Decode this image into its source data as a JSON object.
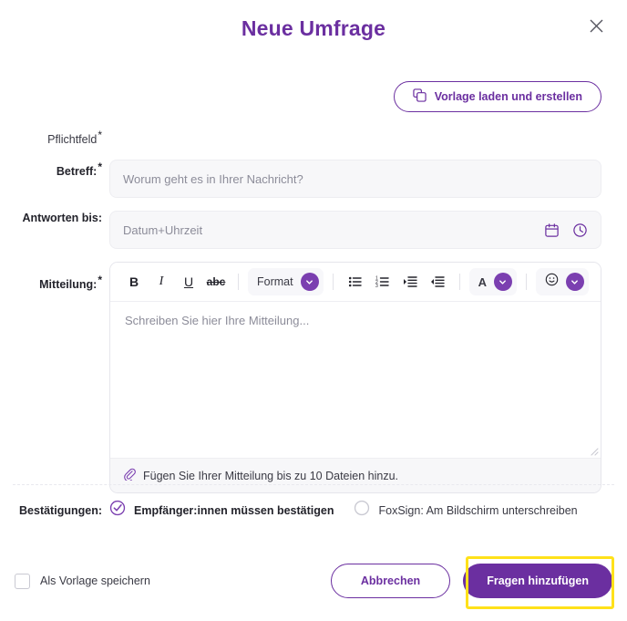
{
  "header": {
    "title": "Neue Umfrage",
    "close_icon": "close-icon"
  },
  "template_button": {
    "label": "Vorlage laden und erstellen",
    "icon": "copy-icon"
  },
  "form": {
    "required_note": "Pflichtfeld",
    "fields": [
      {
        "label": "Betreff:",
        "required": true,
        "placeholder": "Worum geht es in Ihrer Nachricht?",
        "value": ""
      },
      {
        "label": "Antworten bis:",
        "required": false,
        "placeholder": "Datum+Uhrzeit",
        "value": "",
        "icons": [
          "calendar-icon",
          "clock-icon"
        ]
      },
      {
        "label": "Mitteilung:",
        "required": true,
        "placeholder": "Schreiben Sie hier Ihre Mitteilung...",
        "value": ""
      }
    ]
  },
  "editor": {
    "toolbar": {
      "bold": "B",
      "italic": "I",
      "underline": "U",
      "strikethrough": "abc",
      "format_label": "Format",
      "bullet_list": "bullet-list-icon",
      "numbered_list": "numbered-list-icon",
      "indent": "indent-icon",
      "outdent": "outdent-icon",
      "font_color_label": "A",
      "emoji_label": "emoji-icon"
    },
    "attachment_hint": "Fügen Sie Ihrer Mitteilung bis zu 10 Dateien hinzu.",
    "attachment_icon": "paperclip-icon"
  },
  "confirmations": {
    "label": "Bestätigungen:",
    "options": [
      {
        "label": "Empfänger:innen müssen bestätigen",
        "selected": true
      },
      {
        "label": "FoxSign: Am Bildschirm unterschreiben",
        "selected": false
      }
    ]
  },
  "footer": {
    "save_template_label": "Als Vorlage speichern",
    "save_template_checked": false,
    "cancel_label": "Abbrechen",
    "submit_label": "Fragen hinzufügen"
  },
  "colors": {
    "accent": "#6b2fa0",
    "highlight": "#ffe11a",
    "field_bg": "#f7f7f9"
  }
}
